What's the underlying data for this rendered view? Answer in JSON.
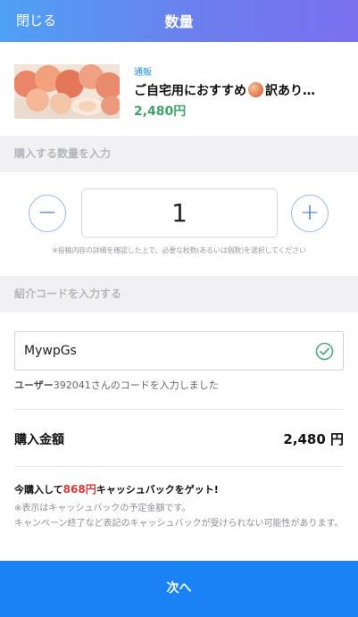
{
  "header": {
    "close_label": "閉じる",
    "title": "数量"
  },
  "product": {
    "tag": "通販",
    "name_before": "ご自宅用におすすめ",
    "name_after": "訳あり…",
    "emoji_icon": "peach-emoji",
    "price": "2,480円"
  },
  "quantity": {
    "section_label": "購入する数量を入力",
    "minus_symbol": "−",
    "plus_symbol": "+",
    "value": "1",
    "notice": "※投稿内容の詳細を確認した上で、必要な枚数(あるいは個数)を選択してください"
  },
  "referral": {
    "section_label": "紹介コードを入力する",
    "code_value": "MywpGs",
    "note_user": "ユーザー",
    "note_rest": "392041さんのコードを入力しました"
  },
  "total": {
    "label": "購入金額",
    "value": "2,480 円"
  },
  "cashback": {
    "prefix": "今購入して",
    "amount": "868円",
    "suffix": "キャッシュバックをゲット!",
    "fine_print_1": "※表示はキャッシュバックの予定金額です。",
    "fine_print_2": "キャンペーン終了など表記のキャッシュバックが受けられない可能性があります。"
  },
  "footer": {
    "next_label": "次へ"
  },
  "colors": {
    "header_start": "#4fa1f5",
    "header_end": "#7a6ff0",
    "price_green": "#3fa46a",
    "cashback_red": "#d83a3a",
    "button_blue": "#1a82f4"
  }
}
